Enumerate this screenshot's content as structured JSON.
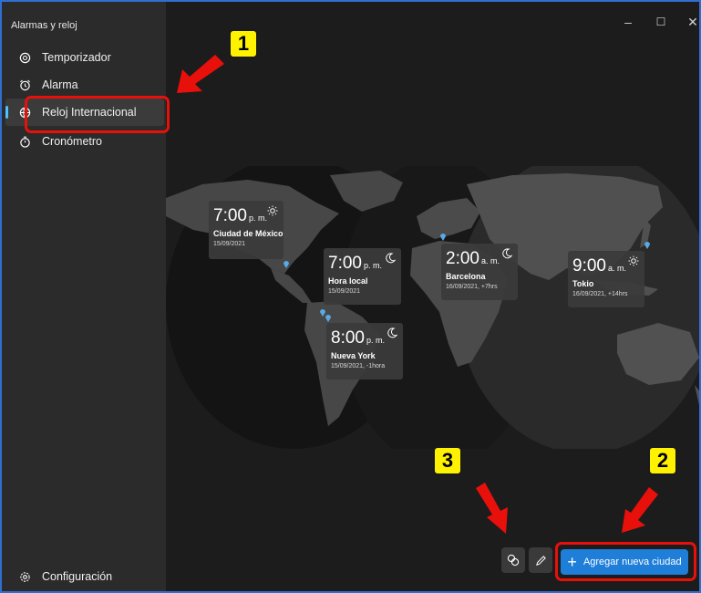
{
  "app": {
    "title": "Alarmas y reloj"
  },
  "window_controls": {
    "minimize": "–",
    "maximize": "☐",
    "close": "✕"
  },
  "sidebar": {
    "items": [
      {
        "label": "Temporizador",
        "icon": "timer-icon"
      },
      {
        "label": "Alarma",
        "icon": "alarm-icon"
      },
      {
        "label": "Reloj Internacional",
        "icon": "world-clock-icon",
        "selected": true
      },
      {
        "label": "Cronómetro",
        "icon": "stopwatch-icon"
      }
    ],
    "settings_label": "Configuración"
  },
  "clocks": [
    {
      "time": "7:00",
      "period": "p. m.",
      "city": "Ciudad de México",
      "date": "15/09/2021",
      "weather": "sun-icon"
    },
    {
      "time": "7:00",
      "period": "p. m.",
      "city": "Hora local",
      "date": "15/09/2021",
      "weather": "moon-icon"
    },
    {
      "time": "2:00",
      "period": "a. m.",
      "city": "Barcelona",
      "date": "16/09/2021, +7hrs",
      "weather": "moon-icon"
    },
    {
      "time": "9:00",
      "period": "a. m.",
      "city": "Tokio",
      "date": "16/09/2021, +14hrs",
      "weather": "sun-icon"
    },
    {
      "time": "8:00",
      "period": "p. m.",
      "city": "Nueva York",
      "date": "15/09/2021, -1hora",
      "weather": "moon-icon"
    }
  ],
  "toolbar": {
    "add_label": "Agregar nueva ciudad",
    "compare_icon": "compare-time-icon",
    "edit_icon": "pencil-icon"
  },
  "annotations": {
    "badge1": "1",
    "badge2": "2",
    "badge3": "3"
  },
  "colors": {
    "sidebar_bg": "#2b2b2b",
    "main_bg": "#1c1c1c",
    "accent": "#1f7ed8",
    "highlight": "#e8100a",
    "badge": "#fff200"
  }
}
